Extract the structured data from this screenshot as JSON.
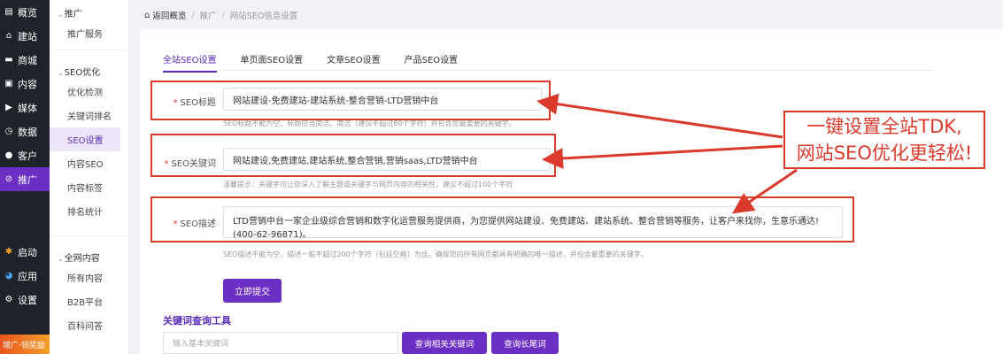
{
  "sidebar_main": {
    "items": [
      {
        "icon": "chart-icon",
        "label": "概览"
      },
      {
        "icon": "home-icon",
        "label": "建站"
      },
      {
        "icon": "shop-icon",
        "label": "商城"
      },
      {
        "icon": "doc-icon",
        "label": "内容"
      },
      {
        "icon": "media-icon",
        "label": "媒体"
      },
      {
        "icon": "clock-icon",
        "label": "数据"
      },
      {
        "icon": "user-icon",
        "label": "客户"
      },
      {
        "icon": "link-icon",
        "label": "推广"
      }
    ],
    "bottom_items": [
      {
        "icon": "launch-icon",
        "label": "启动"
      },
      {
        "icon": "apps-icon",
        "label": "应用"
      },
      {
        "icon": "gear-icon",
        "label": "设置"
      }
    ],
    "promo": "增广·领奖励"
  },
  "sidebar_sub": {
    "group1": "推广",
    "group1_items": [
      "推广服务"
    ],
    "group2": "SEO优化",
    "group2_items": [
      "优化检测",
      "关键词排名",
      "SEO设置",
      "内容SEO",
      "内容标签",
      "排名统计"
    ],
    "group3": "全网内容",
    "group3_items": [
      "所有内容",
      "B2B平台",
      "百科问答"
    ]
  },
  "breadcrumb": {
    "back": "返回概览",
    "level1": "推广",
    "level2": "网站SEO信息设置"
  },
  "tabs": [
    "全站SEO设置",
    "单页面SEO设置",
    "文章SEO设置",
    "产品SEO设置"
  ],
  "form": {
    "title_label": "SEO标题",
    "title_value": "网站建设-免费建站-建站系统-整合营销-LTD营销中台",
    "title_hint": "SEO标题不能为空，标题应当简洁、简洁（建议不超过80个字符）并包含您最重要的关键字。",
    "keywords_label": "SEO关键词",
    "keywords_value": "网站建设,免费建站,建站系统,整合营销,营销saas,LTD营销中台",
    "keywords_hint": "温馨提示：关键字可让您深入了解主题或关键字与网页内容的相关性。建议不超过100个字符",
    "desc_label": "SEO描述",
    "desc_value": "LTD营销中台一家企业级综合营销和数字化运营服务提供商，为您提供网站建设、免费建站、建站系统、整合营销等服务，让客户来找你，生意乐通达!(400-62-96871)。",
    "desc_hint": "SEO描述不能为空，描述一般不超过200个字符（包括空格）为佳。确保您的所有网页都具有明确的唯一描述，并包含最重要的关键字。",
    "submit": "立即提交"
  },
  "tool": {
    "title": "关键词查询工具",
    "placeholder": "输入基本关键词",
    "btn_related": "查询相关关键词",
    "btn_long": "查询长尾词"
  },
  "callout": {
    "line1": "一键设置全站TDK,",
    "line2": "网站SEO优化更轻松!"
  },
  "colors": {
    "accent": "#6b2fc4",
    "annotation_red": "#d93a2c",
    "sidebar_bg": "#1f2229"
  }
}
